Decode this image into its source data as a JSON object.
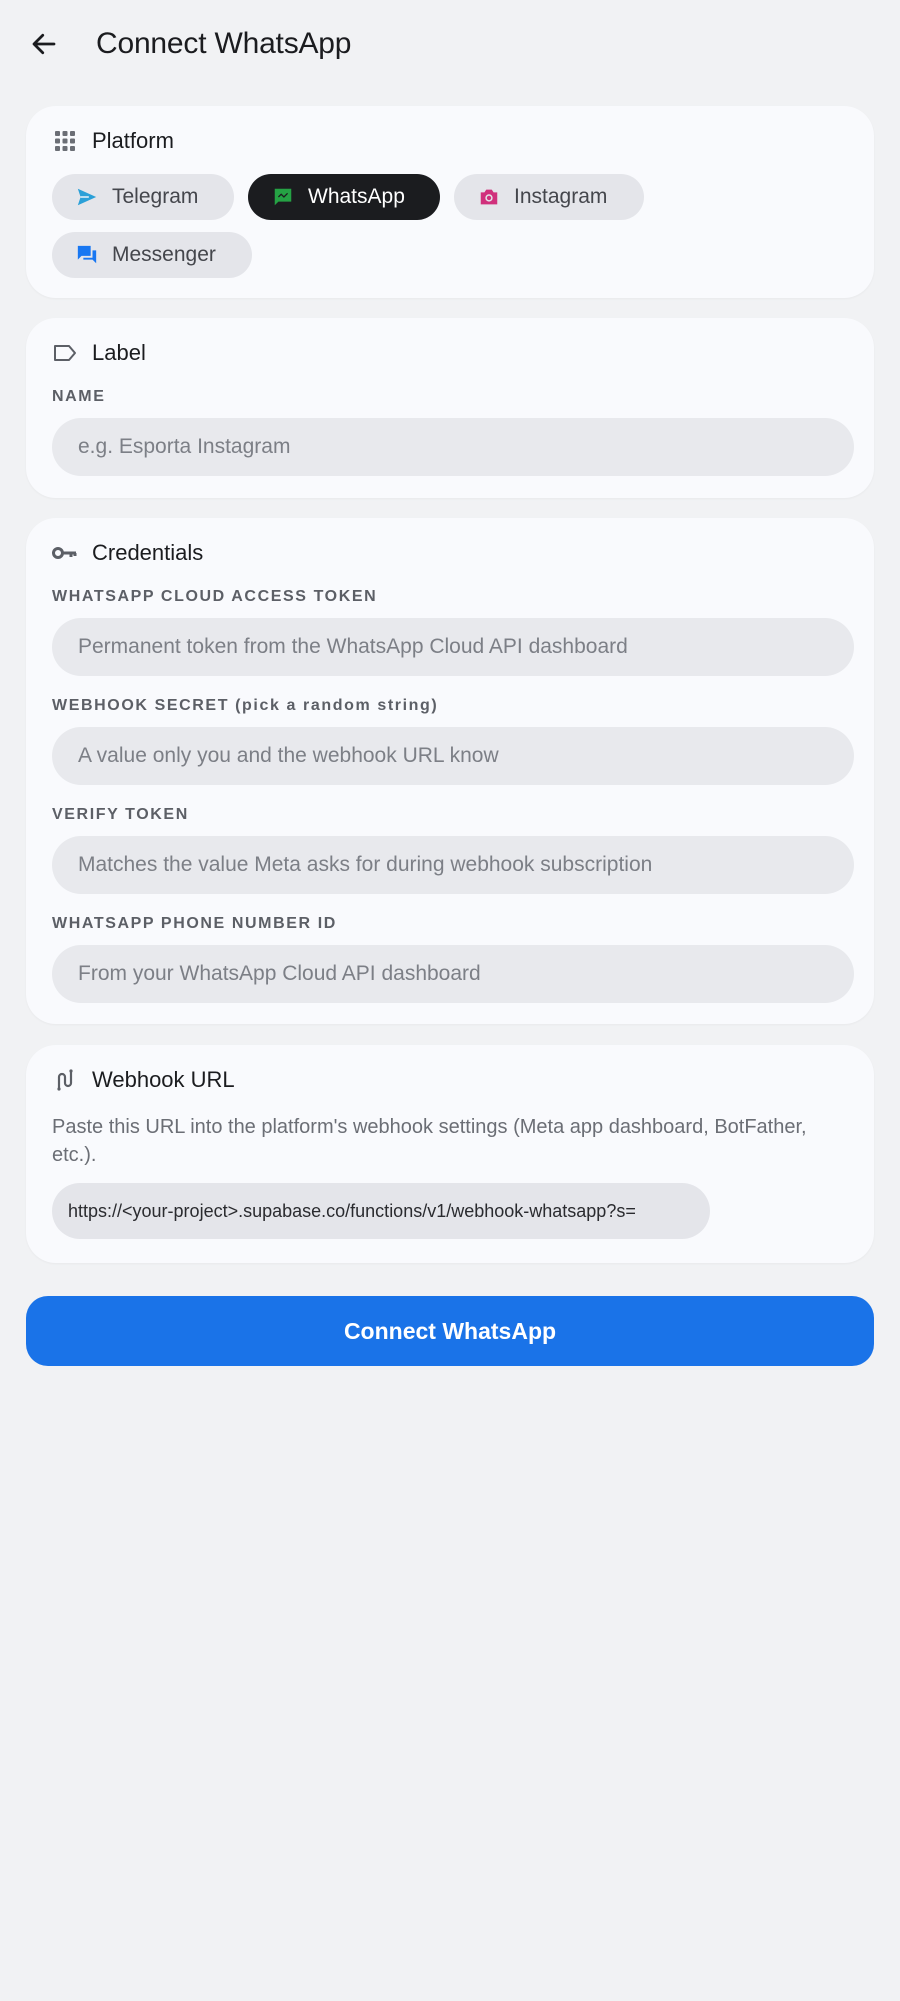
{
  "header": {
    "title": "Connect WhatsApp",
    "back_icon": "arrow-left-icon"
  },
  "platform": {
    "title": "Platform",
    "icon": "grid-icon",
    "selected": "WhatsApp",
    "options": [
      {
        "label": "Telegram",
        "icon": "telegram-send-icon",
        "color": "#2aa0d8"
      },
      {
        "label": "WhatsApp",
        "icon": "chat-bubble-icon",
        "color": "#25a244"
      },
      {
        "label": "Instagram",
        "icon": "camera-icon",
        "color": "#d0307c"
      },
      {
        "label": "Messenger",
        "icon": "forum-icon",
        "color": "#1877f2"
      }
    ]
  },
  "label_section": {
    "title": "Label",
    "icon": "label-tag-icon",
    "name_label": "NAME",
    "name_placeholder": "e.g. Esporta Instagram",
    "name_value": ""
  },
  "credentials": {
    "title": "Credentials",
    "icon": "key-icon",
    "fields": [
      {
        "label": "WHATSAPP CLOUD ACCESS TOKEN",
        "placeholder": "Permanent token from the WhatsApp Cloud API dashboard",
        "value": ""
      },
      {
        "label": "WEBHOOK SECRET (pick a random string)",
        "placeholder": "A value only you and the webhook URL know",
        "value": ""
      },
      {
        "label": "VERIFY TOKEN",
        "placeholder": "Matches the value Meta asks for during webhook subscription",
        "value": ""
      },
      {
        "label": "WHATSAPP PHONE NUMBER ID",
        "placeholder": "From your WhatsApp Cloud API dashboard",
        "value": ""
      }
    ]
  },
  "webhook": {
    "title": "Webhook URL",
    "icon": "webhook-icon",
    "help": "Paste this URL into the platform's webhook settings (Meta app dashboard, BotFather, etc.).",
    "url": "https://<your-project>.supabase.co/functions/v1/webhook-whatsapp?s="
  },
  "actions": {
    "connect_label": "Connect WhatsApp",
    "accent": "#1a73e8"
  }
}
